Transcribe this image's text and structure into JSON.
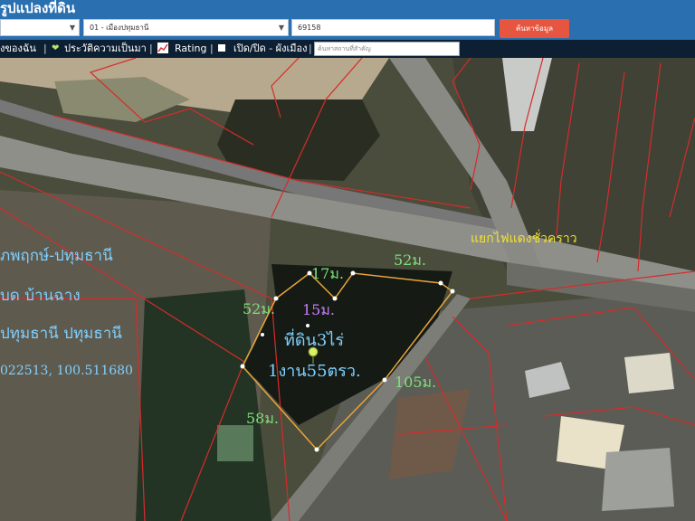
{
  "header": {
    "title": "รูปแปลงที่ดิน",
    "district_select": "01 - เมืองปทุมธานี",
    "parcel_input": "69158",
    "search_button": "ค้นหาข้อมูล"
  },
  "toolbar": {
    "item1": "ังของฉัน",
    "item2": "ประวัติความเป็นมา",
    "item3": "Rating",
    "item4": "เปิด/ปิด - ผังเมือง",
    "place_placeholder": "ค้นหาสถานที่สำคัญ"
  },
  "map": {
    "intersection_label": "แยกไฟแดงชั่วคราว",
    "left_info": {
      "line1": "ภพฤกษ์-ปทุมธานี",
      "line2": "บด บ้านฉาง",
      "line3": "ปทุมธานี ปทุมธานี",
      "coords": "022513, 100.511680"
    },
    "parcel": {
      "label1": "ที่ดิน3ไร่",
      "label2": "1งาน55ตรว.",
      "dimensions": [
        "52ม.",
        "17ม.",
        "15ม.",
        "52ม.",
        "105ม.",
        "58ม."
      ]
    }
  },
  "colors": {
    "header_bg": "#2a6fb0",
    "toolbar_bg": "#0d2033",
    "search_button": "#e6553f",
    "boundary_red": "#d62b2b",
    "parcel_outline": "#e8a43a",
    "dimension_green": "#7fe07a",
    "label_blue": "#7fd0ff",
    "label_purple": "#c77dff",
    "intersection_yellow": "#f2e22e"
  },
  "icons": [
    "dropdown-chevron-icon",
    "sprout-icon",
    "chart-icon",
    "checkbox-square-icon",
    "location-pin-icon"
  ]
}
